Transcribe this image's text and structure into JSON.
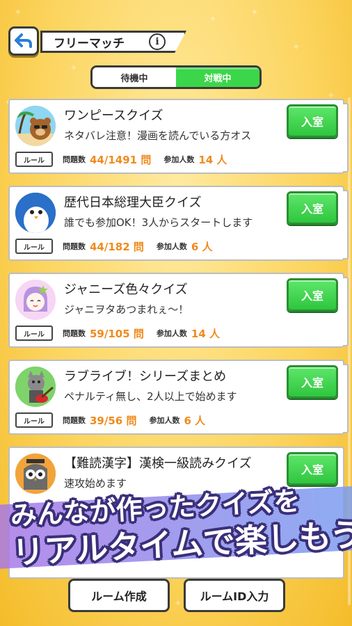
{
  "header": {
    "title": "フリーマッチ",
    "info_icon": "i"
  },
  "tabs": [
    {
      "label": "待機中",
      "active": false
    },
    {
      "label": "対戦中",
      "active": true
    }
  ],
  "common": {
    "enter_label": "入室",
    "rule_label": "ルール",
    "questions_label": "問題数",
    "participants_label": "参加人数"
  },
  "rooms": [
    {
      "title": "ワンピースクイズ",
      "description": "ネタバレ注意！漫画を読んでいる方オス",
      "questions": "44/1491 問",
      "participants": "14 人",
      "avatar_icon": "bear-avatar-icon"
    },
    {
      "title": "歴代日本総理大臣クイズ",
      "description": "誰でも参加OK！3人からスタートします",
      "questions": "44/182 問",
      "participants": "6 人",
      "avatar_icon": "penguin-avatar-icon"
    },
    {
      "title": "ジャニーズ色々クイズ",
      "description": "ジャニヲタあつまれぇ～！",
      "questions": "59/105 問",
      "participants": "14 人",
      "avatar_icon": "girl-avatar-icon"
    },
    {
      "title": "ラブライブ！シリーズまとめ",
      "description": "ペナルティ無し、2人以上で始めます",
      "questions": "39/56 問",
      "participants": "6 人",
      "avatar_icon": "cat-guitar-avatar-icon"
    },
    {
      "title": "【難読漢字】漢検一級読みクイズ",
      "description": "速攻始めます",
      "avatar_icon": "owl-avatar-icon"
    }
  ],
  "bottom": {
    "create_room": "ルーム作成",
    "enter_room_id": "ルームID入力"
  },
  "banner": {
    "line1": "みんなが作ったクイズを",
    "line2": "リアルタイムで楽しもう!"
  },
  "colors": {
    "accent_green": "#3cd64a",
    "stat_orange": "#f08a1c",
    "background_yellow": "#fcd560"
  }
}
